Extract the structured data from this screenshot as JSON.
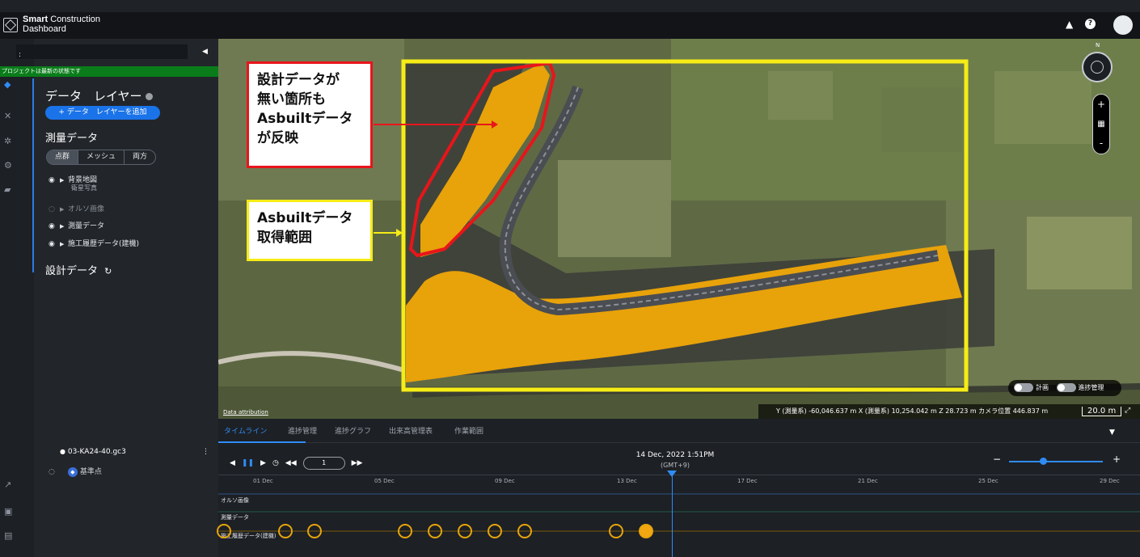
{
  "header": {
    "brand_line1": "Smart",
    "brand_line1b": "Construction",
    "brand_line2": "Dashboard",
    "icons": [
      "bell-icon",
      "help-icon",
      "avatar"
    ]
  },
  "sidebar": {
    "search_value": ":",
    "status_text": "プロジェクトは最新の状態です",
    "layer_title": "データ　レイヤー",
    "add_button": "+ データ　レイヤーを追加",
    "survey_title": "測量データ",
    "segments": [
      "点群",
      "メッシュ",
      "両方"
    ],
    "tree": [
      {
        "label": "背景地図",
        "sub": "衛星写真"
      },
      {
        "label": "オルソ画像"
      },
      {
        "label": "測量データ"
      },
      {
        "label": "施工履歴データ(建機)"
      }
    ],
    "design_title": "設計データ",
    "file_name": "03-KA24-40.gc3",
    "kijun_label": "基準点"
  },
  "map": {
    "callout_red": [
      "設計データが",
      "無い箇所も",
      "Asbuiltデータ",
      "が反映"
    ],
    "callout_yellow": [
      "Asbuiltデータ",
      "取得範囲"
    ],
    "attribution": "Data attribution",
    "coords": "Y (測量系) -60,046.637 m    X (測量系) 10,254.042 m    Z 28.723 m    カメラ位置 446.837 m",
    "scale": "20.0 m",
    "toggle_plan": "計画",
    "toggle_progress": "進捗管理",
    "compass_n": "N",
    "colors": {
      "red": "#e8151b",
      "yellow": "#f6ec16",
      "asbuilt": "#e8a20a"
    }
  },
  "timeline": {
    "tabs": [
      "タイムライン",
      "進捗管理",
      "進捗グラフ",
      "出来高管理表",
      "作業範囲"
    ],
    "page": "1",
    "date": "14 Dec, 2022 1:51PM",
    "gmt": "(GMT+9)",
    "ticks": [
      "01 Dec",
      "05 Dec",
      "09 Dec",
      "13 Dec",
      "17 Dec",
      "21 Dec",
      "25 Dec",
      "29 Dec"
    ],
    "rows": [
      "オルソ画像",
      "測量データ",
      "施工履歴データ(建機)"
    ]
  }
}
